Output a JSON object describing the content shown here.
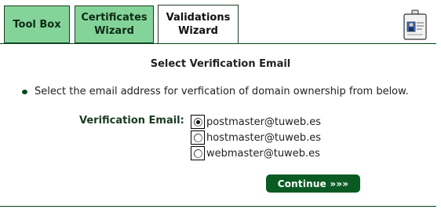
{
  "tabs": [
    {
      "label": "Tool Box",
      "active": false
    },
    {
      "label": "Certificates\nWizard",
      "active": false
    },
    {
      "label": "Validations\nWizard",
      "active": true
    }
  ],
  "header_icon": "id-badge-icon",
  "page": {
    "title": "Select Verification Email",
    "instruction": "Select the email address for verfication of domain ownership from below.",
    "field_label": "Verification Email:",
    "options": [
      {
        "email": "postmaster@tuweb.es",
        "selected": true
      },
      {
        "email": "hostmaster@tuweb.es",
        "selected": false
      },
      {
        "email": "webmaster@tuweb.es",
        "selected": false
      }
    ],
    "continue_label": "Continue »»»"
  },
  "colors": {
    "tab_inactive_bg": "#84d49a",
    "accent_dark_green": "#0a5a24",
    "rule_green": "#004b1f"
  }
}
